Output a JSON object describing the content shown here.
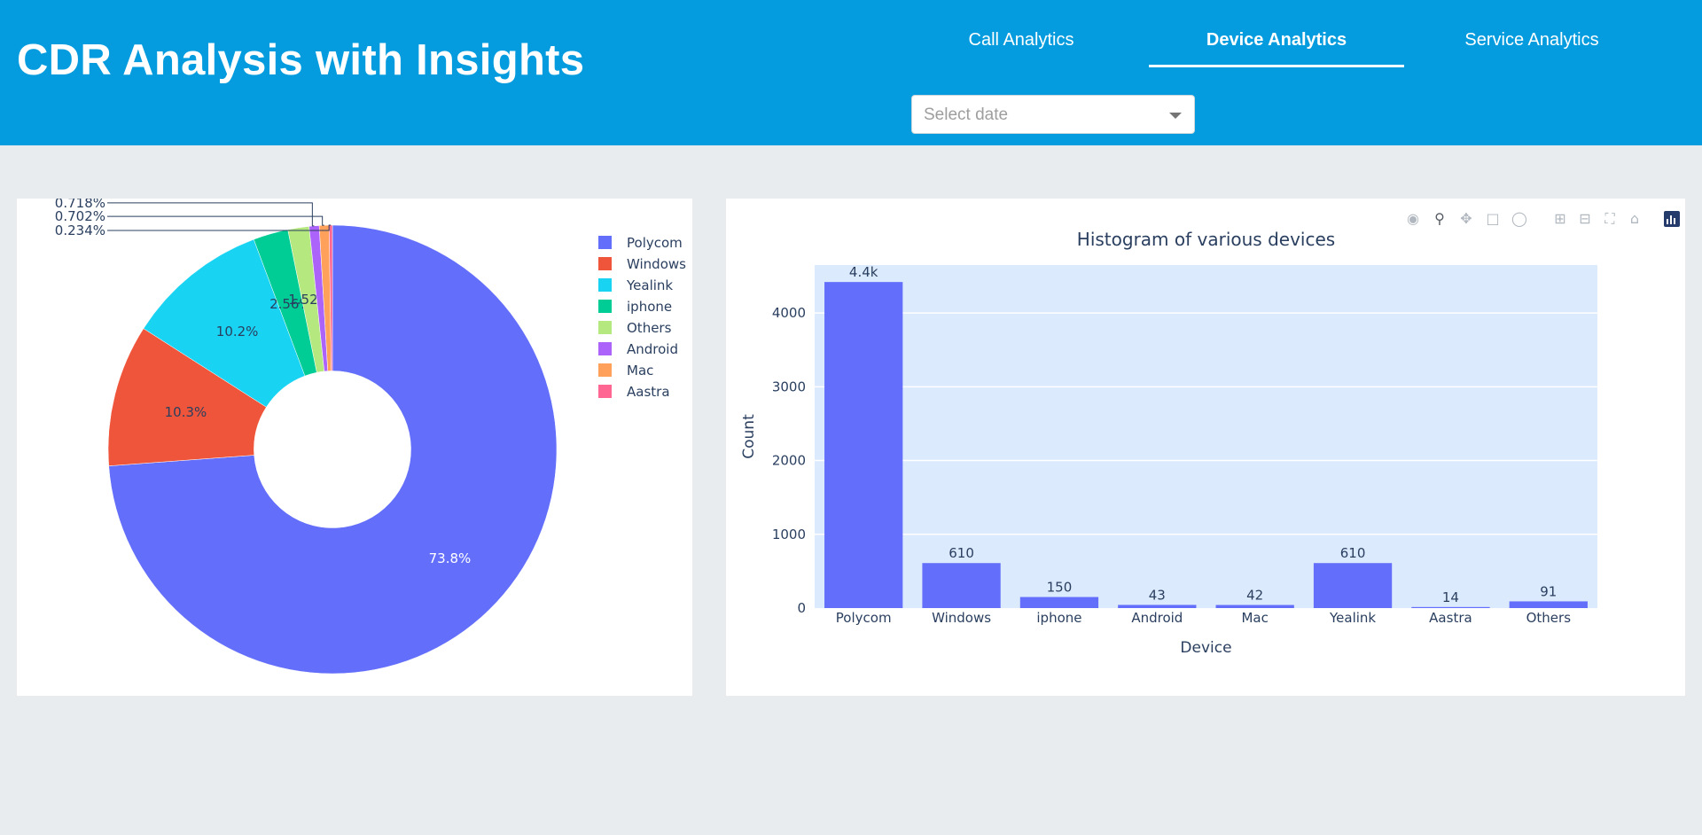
{
  "header": {
    "title": "CDR Analysis with Insights",
    "tabs": [
      {
        "label": "Call Analytics",
        "active": false
      },
      {
        "label": "Device Analytics",
        "active": true
      },
      {
        "label": "Service Analytics",
        "active": false
      }
    ],
    "date_select": {
      "placeholder": "Select date"
    }
  },
  "colors": {
    "header_bg": "#049cde",
    "page_bg": "#e8ecef",
    "plot_bg": "#dbeafd",
    "bar": "#636efa"
  },
  "modebar": {
    "icons": [
      "camera-icon",
      "zoom-icon",
      "pan-icon",
      "box-select-icon",
      "lasso-select-icon",
      "zoom-in-icon",
      "zoom-out-icon",
      "autoscale-icon",
      "reset-axes-icon",
      "plotly-logo-icon"
    ]
  },
  "chart_data": [
    {
      "type": "pie",
      "hole": 0.35,
      "labels": [
        "Polycom",
        "Windows",
        "Yealink",
        "iphone",
        "Others",
        "Android",
        "Mac",
        "Aastra"
      ],
      "values": [
        4400,
        610,
        610,
        150,
        91,
        43,
        42,
        14
      ],
      "percent_labels": [
        "73.8%",
        "10.3%",
        "10.2%",
        "2.56%",
        "1.52%",
        "0.718%",
        "0.702%",
        "0.234%"
      ],
      "colors": [
        "#636efa",
        "#ef553b",
        "#19d3f3",
        "#00cc96",
        "#b6e880",
        "#ab63fa",
        "#ffa15a",
        "#ff6692"
      ],
      "legend_position": "top-right"
    },
    {
      "type": "bar",
      "title": "Histogram of various devices",
      "xlabel": "Device",
      "ylabel": "Count",
      "categories": [
        "Polycom",
        "Windows",
        "iphone",
        "Android",
        "Mac",
        "Yealink",
        "Aastra",
        "Others"
      ],
      "values": [
        4420,
        610,
        150,
        43,
        42,
        610,
        14,
        91
      ],
      "value_labels": [
        "4.4k",
        "610",
        "150",
        "43",
        "42",
        "610",
        "14",
        "91"
      ],
      "yticks": [
        0,
        1000,
        2000,
        3000,
        4000
      ],
      "ylim": [
        0,
        4650
      ],
      "grid": true
    }
  ]
}
